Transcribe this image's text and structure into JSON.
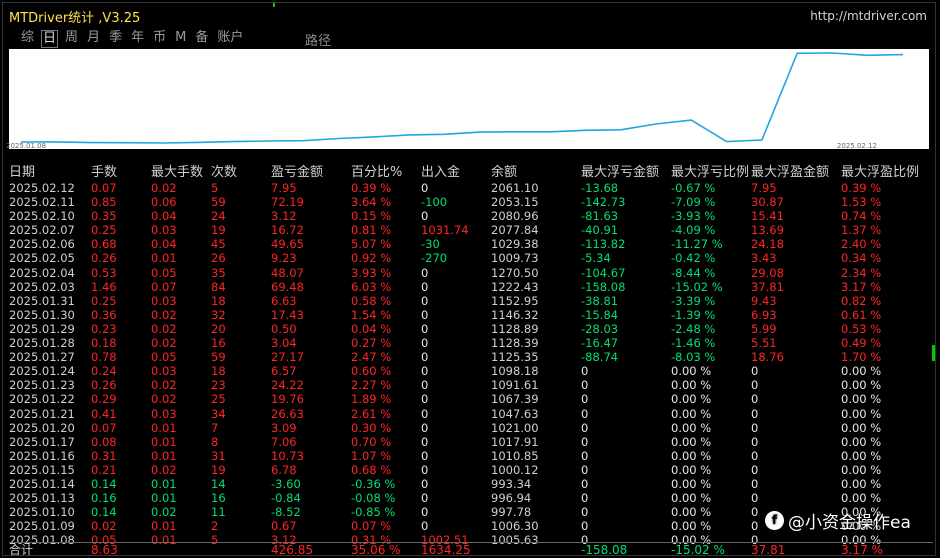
{
  "app": {
    "title": "MTDriver统计 ,V3.25",
    "site": "http://mtdriver.com"
  },
  "tabs": [
    {
      "label": "综",
      "active": false
    },
    {
      "label": "日",
      "active": true
    },
    {
      "label": "周",
      "active": false
    },
    {
      "label": "月",
      "active": false
    },
    {
      "label": "季",
      "active": false
    },
    {
      "label": "年",
      "active": false
    },
    {
      "label": "币",
      "active": false
    },
    {
      "label": "M",
      "active": false
    },
    {
      "label": "备",
      "active": false
    },
    {
      "label": "账户",
      "active": false
    }
  ],
  "route_label": "路径",
  "chart_data": {
    "type": "line",
    "x_start_label": "2025.01.08",
    "x_end_label": "2025.02.12",
    "x": [
      "2025.01.08",
      "2025.01.09",
      "2025.01.10",
      "2025.01.13",
      "2025.01.14",
      "2025.01.15",
      "2025.01.16",
      "2025.01.17",
      "2025.01.20",
      "2025.01.21",
      "2025.01.22",
      "2025.01.23",
      "2025.01.24",
      "2025.01.27",
      "2025.01.28",
      "2025.01.29",
      "2025.01.30",
      "2025.01.31",
      "2025.02.03",
      "2025.02.04",
      "2025.02.05",
      "2025.02.06",
      "2025.02.07",
      "2025.02.10",
      "2025.02.11",
      "2025.02.12"
    ],
    "y": [
      1005.63,
      1006.3,
      997.78,
      996.94,
      993.34,
      1000.12,
      1010.85,
      1017.91,
      1021.0,
      1047.63,
      1067.39,
      1091.61,
      1098.18,
      1125.35,
      1128.39,
      1128.89,
      1146.32,
      1152.95,
      1222.43,
      1270.5,
      1009.73,
      1029.38,
      2077.84,
      2080.96,
      2053.15,
      2061.1
    ],
    "line_color": "#1ea7e0"
  },
  "table": {
    "headers": [
      "日期",
      "手数",
      "最大手数",
      "次数",
      "盈亏金额",
      "百分比%",
      "出入金",
      "余额",
      "最大浮亏金额",
      "最大浮亏比例",
      "最大浮盈金额",
      "最大浮盈比例"
    ],
    "rows": [
      [
        "2025.02.12",
        "0.07",
        "0.02",
        "5",
        "7.95",
        "0.39 %",
        "0",
        "2061.10",
        "-13.68",
        "-0.67 %",
        "7.95",
        "0.39 %"
      ],
      [
        "2025.02.11",
        "0.85",
        "0.06",
        "59",
        "72.19",
        "3.64 %",
        "-100",
        "2053.15",
        "-142.73",
        "-7.09 %",
        "30.87",
        "1.53 %"
      ],
      [
        "2025.02.10",
        "0.35",
        "0.04",
        "24",
        "3.12",
        "0.15 %",
        "0",
        "2080.96",
        "-81.63",
        "-3.93 %",
        "15.41",
        "0.74 %"
      ],
      [
        "2025.02.07",
        "0.25",
        "0.03",
        "19",
        "16.72",
        "0.81 %",
        "1031.74",
        "2077.84",
        "-40.91",
        "-4.09 %",
        "13.69",
        "1.37 %"
      ],
      [
        "2025.02.06",
        "0.68",
        "0.04",
        "45",
        "49.65",
        "5.07 %",
        "-30",
        "1029.38",
        "-113.82",
        "-11.27 %",
        "24.18",
        "2.40 %"
      ],
      [
        "2025.02.05",
        "0.26",
        "0.01",
        "26",
        "9.23",
        "0.92 %",
        "-270",
        "1009.73",
        "-5.34",
        "-0.42 %",
        "3.43",
        "0.34 %"
      ],
      [
        "2025.02.04",
        "0.53",
        "0.05",
        "35",
        "48.07",
        "3.93 %",
        "0",
        "1270.50",
        "-104.67",
        "-8.44 %",
        "29.08",
        "2.34 %"
      ],
      [
        "2025.02.03",
        "1.46",
        "0.07",
        "84",
        "69.48",
        "6.03 %",
        "0",
        "1222.43",
        "-158.08",
        "-15.02 %",
        "37.81",
        "3.17 %"
      ],
      [
        "2025.01.31",
        "0.25",
        "0.03",
        "18",
        "6.63",
        "0.58 %",
        "0",
        "1152.95",
        "-38.81",
        "-3.39 %",
        "9.43",
        "0.82 %"
      ],
      [
        "2025.01.30",
        "0.36",
        "0.02",
        "32",
        "17.43",
        "1.54 %",
        "0",
        "1146.32",
        "-15.84",
        "-1.39 %",
        "6.93",
        "0.61 %"
      ],
      [
        "2025.01.29",
        "0.23",
        "0.02",
        "20",
        "0.50",
        "0.04 %",
        "0",
        "1128.89",
        "-28.03",
        "-2.48 %",
        "5.99",
        "0.53 %"
      ],
      [
        "2025.01.28",
        "0.18",
        "0.02",
        "16",
        "3.04",
        "0.27 %",
        "0",
        "1128.39",
        "-16.47",
        "-1.46 %",
        "5.51",
        "0.49 %"
      ],
      [
        "2025.01.27",
        "0.78",
        "0.05",
        "59",
        "27.17",
        "2.47 %",
        "0",
        "1125.35",
        "-88.74",
        "-8.03 %",
        "18.76",
        "1.70 %"
      ],
      [
        "2025.01.24",
        "0.24",
        "0.03",
        "18",
        "6.57",
        "0.60 %",
        "0",
        "1098.18",
        "0",
        "0.00 %",
        "0",
        "0.00 %"
      ],
      [
        "2025.01.23",
        "0.26",
        "0.02",
        "23",
        "24.22",
        "2.27 %",
        "0",
        "1091.61",
        "0",
        "0.00 %",
        "0",
        "0.00 %"
      ],
      [
        "2025.01.22",
        "0.29",
        "0.02",
        "25",
        "19.76",
        "1.89 %",
        "0",
        "1067.39",
        "0",
        "0.00 %",
        "0",
        "0.00 %"
      ],
      [
        "2025.01.21",
        "0.41",
        "0.03",
        "34",
        "26.63",
        "2.61 %",
        "0",
        "1047.63",
        "0",
        "0.00 %",
        "0",
        "0.00 %"
      ],
      [
        "2025.01.20",
        "0.07",
        "0.01",
        "7",
        "3.09",
        "0.30 %",
        "0",
        "1021.00",
        "0",
        "0.00 %",
        "0",
        "0.00 %"
      ],
      [
        "2025.01.17",
        "0.08",
        "0.01",
        "8",
        "7.06",
        "0.70 %",
        "0",
        "1017.91",
        "0",
        "0.00 %",
        "0",
        "0.00 %"
      ],
      [
        "2025.01.16",
        "0.31",
        "0.01",
        "31",
        "10.73",
        "1.07 %",
        "0",
        "1010.85",
        "0",
        "0.00 %",
        "0",
        "0.00 %"
      ],
      [
        "2025.01.15",
        "0.21",
        "0.02",
        "19",
        "6.78",
        "0.68 %",
        "0",
        "1000.12",
        "0",
        "0.00 %",
        "0",
        "0.00 %"
      ],
      [
        "2025.01.14",
        "0.14",
        "0.01",
        "14",
        "-3.60",
        "-0.36 %",
        "0",
        "993.34",
        "0",
        "0.00 %",
        "0",
        "0.00 %"
      ],
      [
        "2025.01.13",
        "0.16",
        "0.01",
        "16",
        "-0.84",
        "-0.08 %",
        "0",
        "996.94",
        "0",
        "0.00 %",
        "0",
        "0.00 %"
      ],
      [
        "2025.01.10",
        "0.14",
        "0.02",
        "11",
        "-8.52",
        "-0.85 %",
        "0",
        "997.78",
        "0",
        "0.00 %",
        "0",
        "0.00 %"
      ],
      [
        "2025.01.09",
        "0.02",
        "0.01",
        "2",
        "0.67",
        "0.07 %",
        "0",
        "1006.30",
        "0",
        "0.00 %",
        "0",
        "0.00 %"
      ],
      [
        "2025.01.08",
        "0.05",
        "0.01",
        "5",
        "3.12",
        "0.31 %",
        "1002.51",
        "1005.63",
        "0",
        "0.00 %",
        "0",
        "0.00 %"
      ]
    ],
    "totals": [
      "合计",
      "8.63",
      "",
      "",
      "426.85",
      "35.06 %",
      "1634.25",
      "",
      "-158.08",
      "-15.02 %",
      "37.81",
      "3.17 %"
    ]
  },
  "colors": {
    "profit": "#ff2525",
    "loss": "#00e070",
    "neutral": "#e8e8e8",
    "title": "#ffe04a"
  },
  "watermark": {
    "icon": "f-icon",
    "text": "@小资金操作ea"
  }
}
